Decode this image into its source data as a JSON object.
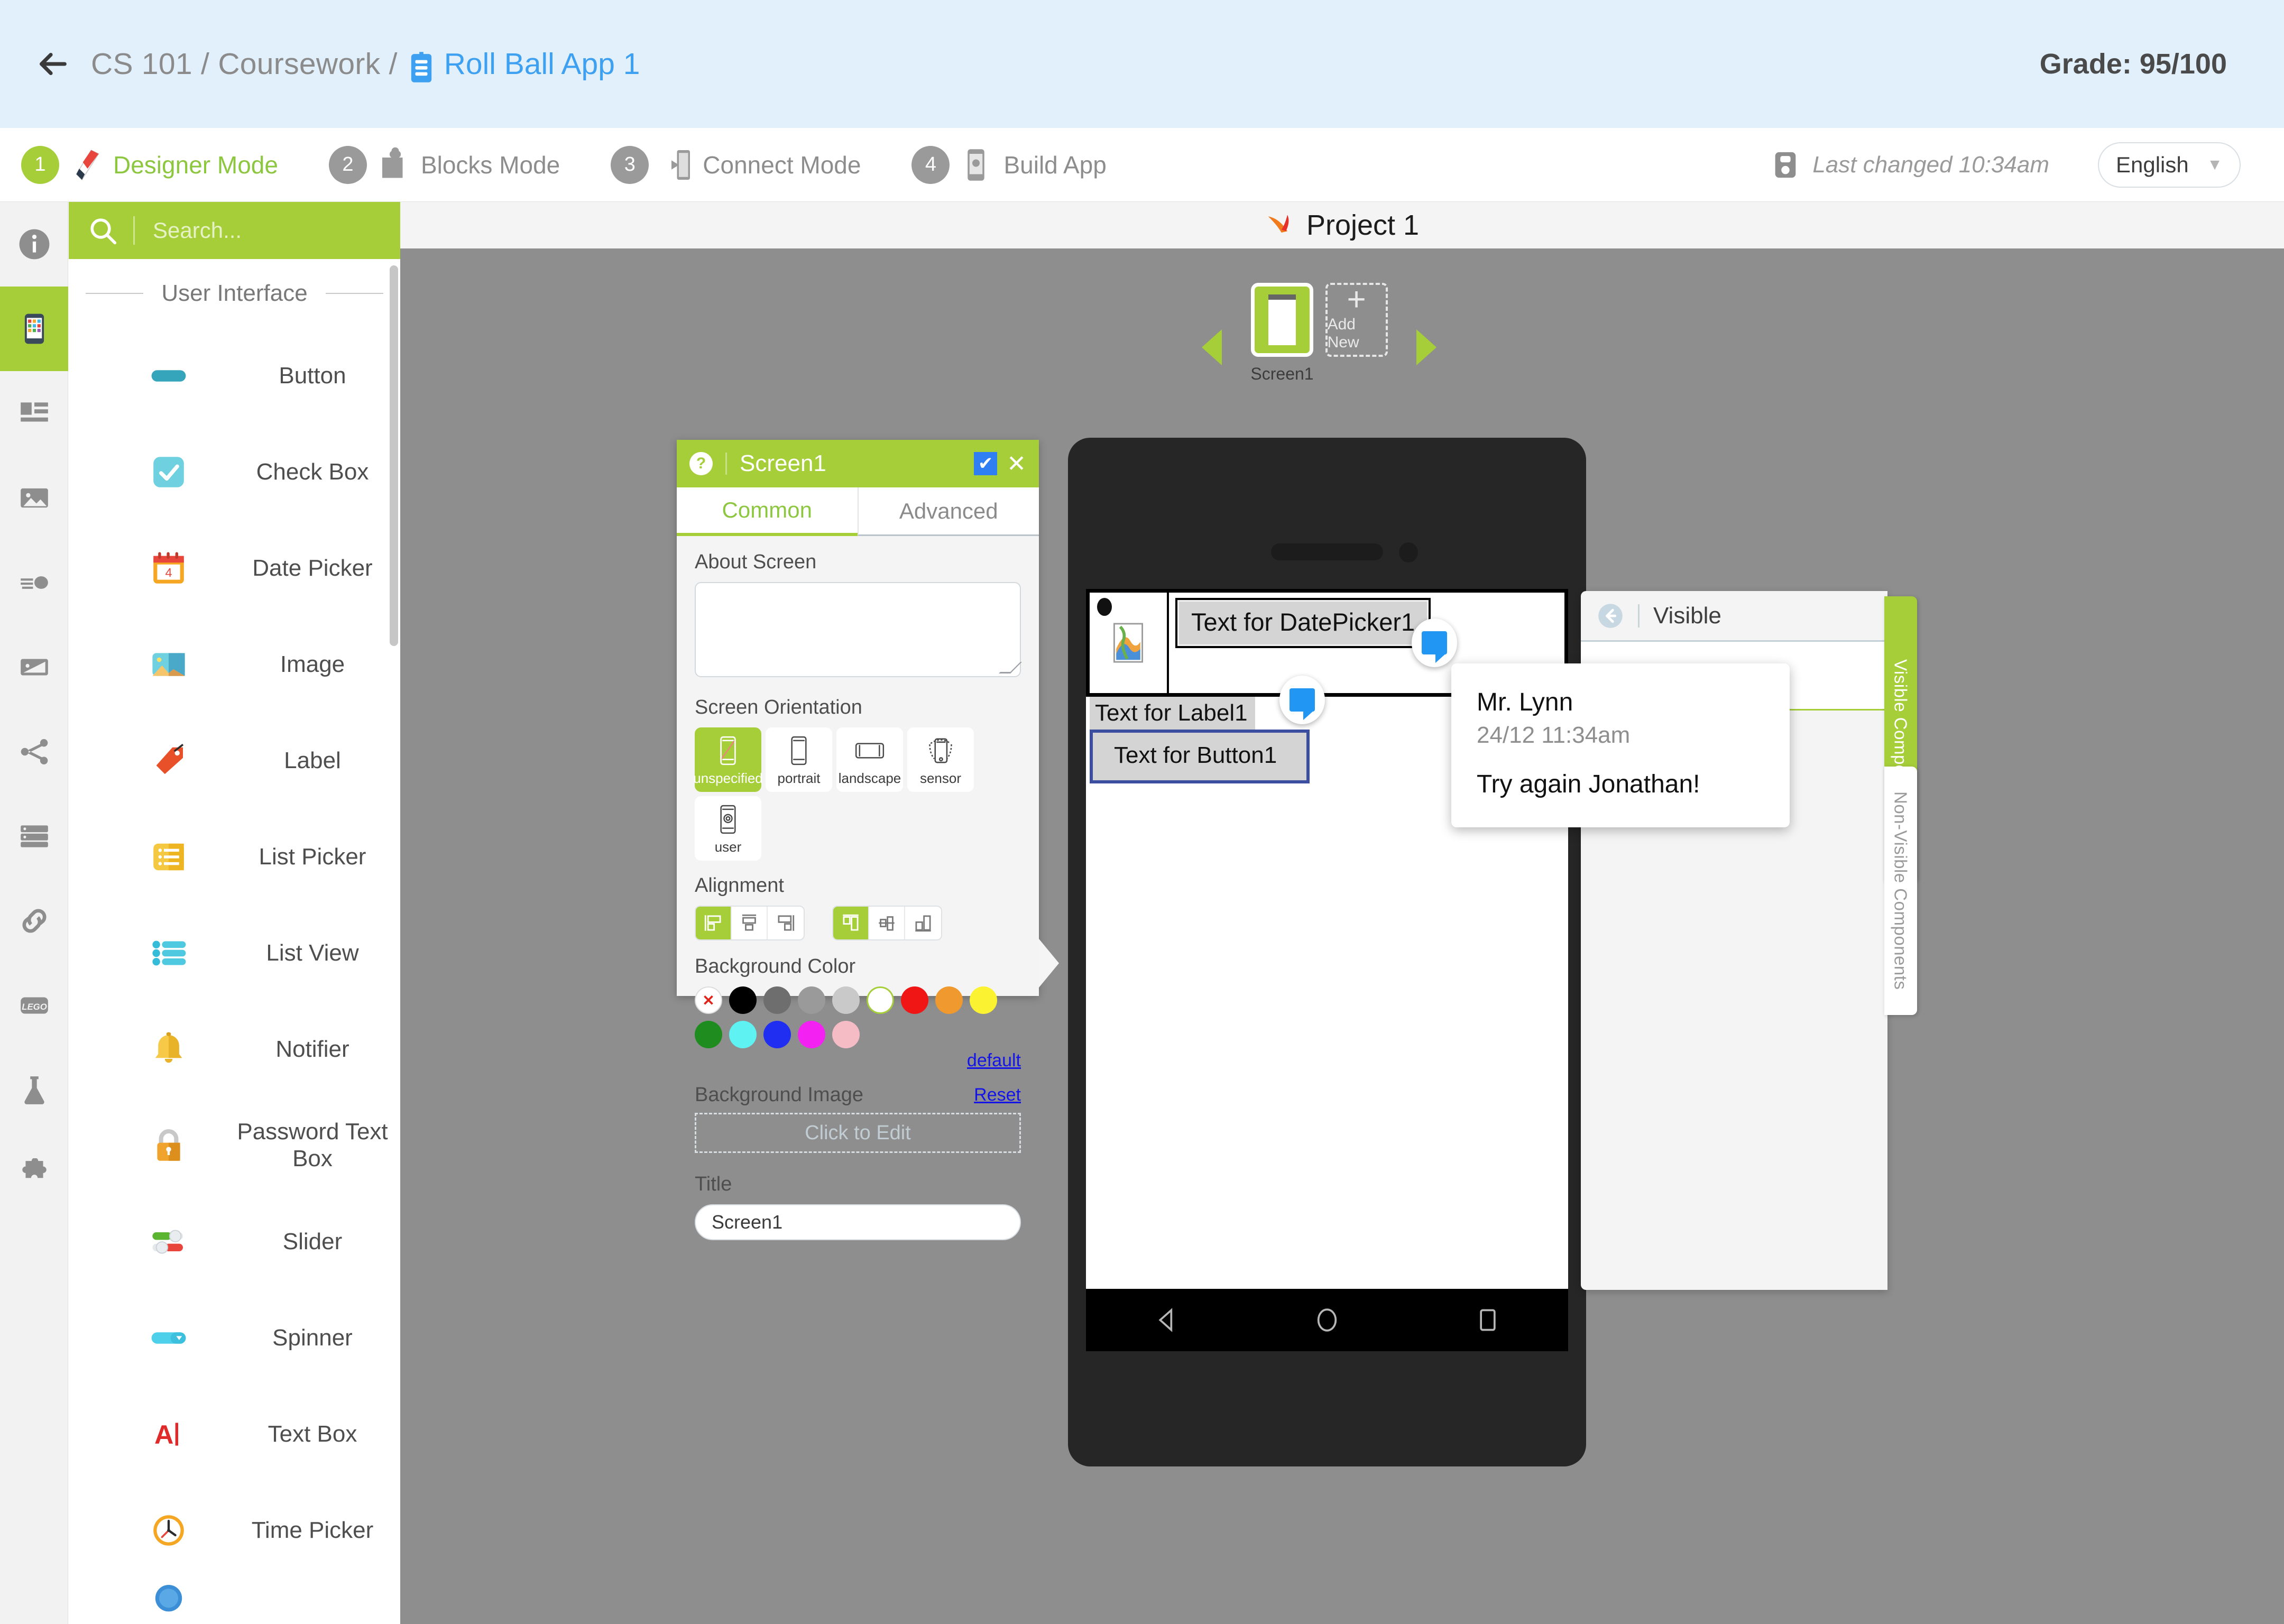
{
  "header": {
    "breadcrumb_course": "CS 101",
    "breadcrumb_section": "Coursework",
    "breadcrumb_sep": "/",
    "breadcrumb_project": "Roll Ball App 1",
    "grade": "Grade: 95/100"
  },
  "modes": [
    {
      "num": "1",
      "label": "Designer Mode",
      "active": true
    },
    {
      "num": "2",
      "label": "Blocks Mode",
      "active": false
    },
    {
      "num": "3",
      "label": "Connect Mode",
      "active": false
    },
    {
      "num": "4",
      "label": "Build App",
      "active": false
    }
  ],
  "toolbar": {
    "last_changed": "Last changed 10:34am",
    "language": "English",
    "caret": "▼"
  },
  "palette": {
    "search_placeholder": "Search...",
    "section_title": "User Interface",
    "items": [
      {
        "label": "Button",
        "icon": "button-icon"
      },
      {
        "label": "Check Box",
        "icon": "checkbox-icon"
      },
      {
        "label": "Date Picker",
        "icon": "calendar-icon"
      },
      {
        "label": "Image",
        "icon": "image-icon"
      },
      {
        "label": "Label",
        "icon": "tag-icon"
      },
      {
        "label": "List Picker",
        "icon": "list-picker-icon"
      },
      {
        "label": "List View",
        "icon": "list-view-icon"
      },
      {
        "label": "Notifier",
        "icon": "bell-icon"
      },
      {
        "label": "Password Text Box",
        "icon": "lock-icon"
      },
      {
        "label": "Slider",
        "icon": "slider-icon"
      },
      {
        "label": "Spinner",
        "icon": "spinner-icon"
      },
      {
        "label": "Text Box",
        "icon": "textbox-icon"
      },
      {
        "label": "Time Picker",
        "icon": "clock-icon"
      }
    ]
  },
  "project": {
    "title": "Project 1",
    "screen_label": "Screen1",
    "add_new_label": "Add New",
    "add_new_plus": "+"
  },
  "properties": {
    "help_glyph": "?",
    "title": "Screen1",
    "check_glyph": "✔",
    "close_glyph": "✕",
    "tabs": [
      {
        "label": "Common",
        "active": true
      },
      {
        "label": "Advanced",
        "active": false
      }
    ],
    "about_screen_label": "About Screen",
    "about_screen_value": "",
    "screen_orientation_label": "Screen Orientation",
    "orientations": [
      {
        "label": "unspecified",
        "selected": true
      },
      {
        "label": "portrait",
        "selected": false
      },
      {
        "label": "landscape",
        "selected": false
      },
      {
        "label": "sensor",
        "selected": false
      },
      {
        "label": "user",
        "selected": false
      }
    ],
    "alignment_label": "Alignment",
    "background_color_label": "Background Color",
    "swatches": [
      {
        "name": "none",
        "hex": "#ffffff"
      },
      {
        "name": "black",
        "hex": "#000000"
      },
      {
        "name": "dark-gray",
        "hex": "#6e6e6e"
      },
      {
        "name": "gray",
        "hex": "#9a9a9a"
      },
      {
        "name": "light-gray",
        "hex": "#c9c9c9"
      },
      {
        "name": "white",
        "hex": "#ffffff"
      },
      {
        "name": "red",
        "hex": "#f01616"
      },
      {
        "name": "orange",
        "hex": "#f0992e"
      },
      {
        "name": "yellow",
        "hex": "#fbf231"
      },
      {
        "name": "green",
        "hex": "#1e8c1e"
      },
      {
        "name": "cyan",
        "hex": "#5ef2f2"
      },
      {
        "name": "blue",
        "hex": "#1f2ef0"
      },
      {
        "name": "magenta",
        "hex": "#f322f3"
      },
      {
        "name": "pink",
        "hex": "#f5bcc6"
      }
    ],
    "default_link": "default",
    "background_image_label": "Background Image",
    "reset_link": "Reset",
    "click_to_edit": "Click to Edit",
    "title_label": "Title",
    "title_value": "Screen1"
  },
  "phone_screen": {
    "datepicker_text": "Text for DatePicker1",
    "label_text": "Text for Label1",
    "button_text": "Text for Button1"
  },
  "visible_panel": {
    "title": "Visible"
  },
  "side_tabs": {
    "visible": "Visible Components",
    "non_visible": "Non-Visible Components"
  },
  "comment": {
    "author": "Mr. Lynn",
    "timestamp": "24/12 11:34am",
    "body": "Try again Jonathan!"
  },
  "colors": {
    "accent_green": "#a5ce39",
    "header_blue": "#e2f0fb",
    "link_blue": "#3ea0f0",
    "canvas_gray": "#8e8e8e"
  }
}
